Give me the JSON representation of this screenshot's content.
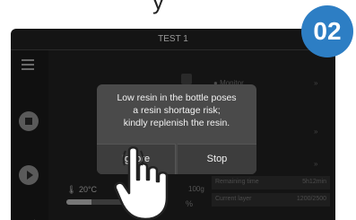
{
  "screen": {
    "title": "TEST 1",
    "monitor_label": "Monitor",
    "temperature": "20°C",
    "temperature_level": 0.25,
    "weight": "100g",
    "progress_percent": "%",
    "remaining_time_label": "Remaining time",
    "remaining_time_value": "5h12min",
    "current_layer_label": "Current layer",
    "current_layer_value": "1200/2500"
  },
  "dialog": {
    "message_lines": [
      "Low resin in the bottle poses",
      "a resin shortage risk;",
      "kindly replenish the resin."
    ],
    "ignore_label": "Ignore",
    "stop_label": "Stop"
  },
  "step_badge": "02",
  "colors": {
    "badge": "#2d7ec4",
    "dialog": "#4a4a4a",
    "screen_bg": "#141414"
  },
  "icons": [
    "menu-icon",
    "stop-icon",
    "play-icon",
    "chart-icon",
    "hand-pointer-icon"
  ]
}
